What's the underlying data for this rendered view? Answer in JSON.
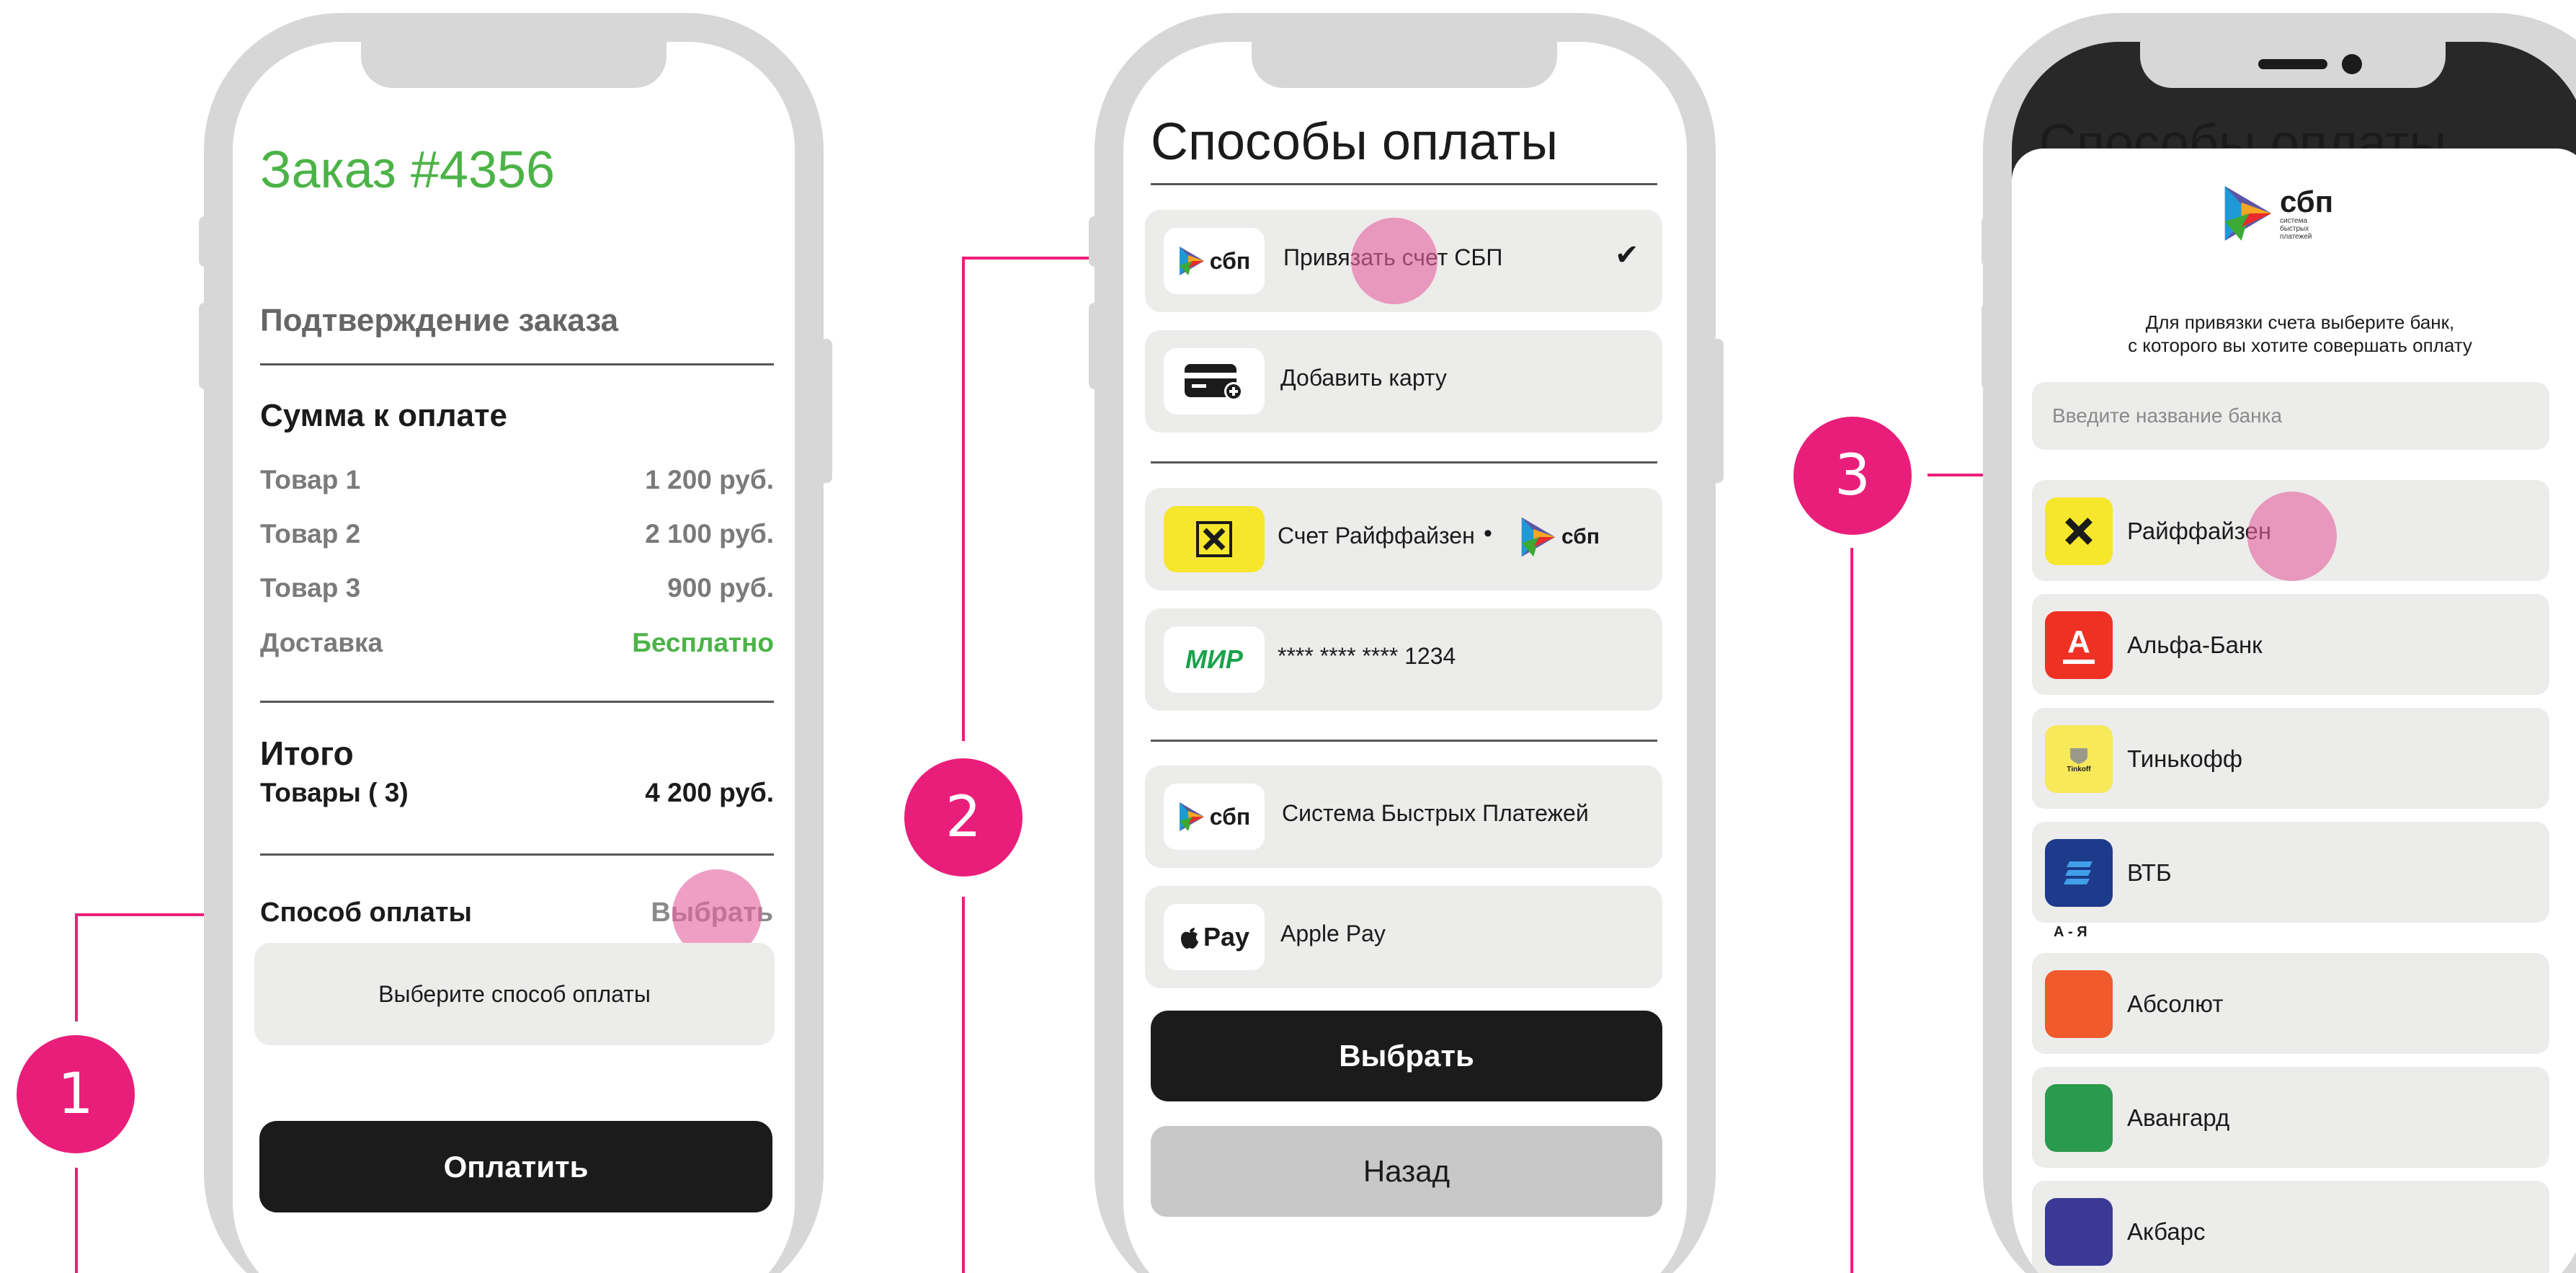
{
  "colors": {
    "accent": "#e91e7a",
    "green": "#4cb347",
    "dark": "#1b1b1b",
    "card": "#ececeb"
  },
  "steps": [
    "1",
    "2",
    "3"
  ],
  "screen1": {
    "title": "Заказ #4356",
    "subtitle": "Подтверждение заказа",
    "sum_heading": "Сумма к оплате",
    "items": [
      {
        "label": "Товар 1",
        "value": "1 200 руб."
      },
      {
        "label": "Товар 2",
        "value": "2 100 руб."
      },
      {
        "label": "Товар 3",
        "value": "900 руб."
      },
      {
        "label": "Доставка",
        "value": "Бесплатно"
      }
    ],
    "total_heading": "Итого",
    "total_label": "Товары ( 3)",
    "total_value": "4 200 руб.",
    "payment_label": "Способ оплаты",
    "choose_link": "Выбрать",
    "payment_placeholder": "Выберите способ оплаты",
    "pay_button": "Оплатить"
  },
  "screen2": {
    "title": "Способы оплаты",
    "options": [
      {
        "icon": "sbp-logo-icon",
        "label": "Привязать счет СБП",
        "selected": true
      },
      {
        "icon": "add-card-icon",
        "label": "Добавить карту"
      },
      {
        "icon": "raiffeisen-logo-icon",
        "label": "Счет Райффайзен"
      },
      {
        "icon": "mir-logo-icon",
        "label": "**** **** **** 1234"
      },
      {
        "icon": "sbp-logo-icon",
        "label": "Система Быстрых Платежей"
      },
      {
        "icon": "apple-pay-icon",
        "label": "Apple Pay"
      }
    ],
    "sbp_text": "сбп",
    "mir_text": "МИР",
    "pay_text": "Pay",
    "select_button": "Выбрать",
    "back_button": "Назад"
  },
  "screen3": {
    "bg_title": "Способы оплаты",
    "logo_text": "сбп",
    "logo_sub": "система быстрых платежей",
    "instruction_1": "Для привязки счета выберите банк,",
    "instruction_2": "с которого вы хотите совершать оплату",
    "search_placeholder": "Введите название банка",
    "banks": [
      {
        "name": "Райффайзен",
        "color": "#f6e72d"
      },
      {
        "name": "Альфа-Банк",
        "color": "#ef3124"
      },
      {
        "name": "Тинькофф",
        "color": "#f7e95a"
      },
      {
        "name": "ВТБ",
        "color": "#1e3a8a"
      }
    ],
    "tinkoff_text": "Tinkoff",
    "alpha_letter": "А",
    "section_label": "А - Я",
    "banks_az": [
      {
        "name": "Абсолют",
        "color": "#f15a2c"
      },
      {
        "name": "Авангард",
        "color": "#2a9a4e"
      },
      {
        "name": "Акбарс",
        "color": "#3a3a96"
      }
    ]
  }
}
